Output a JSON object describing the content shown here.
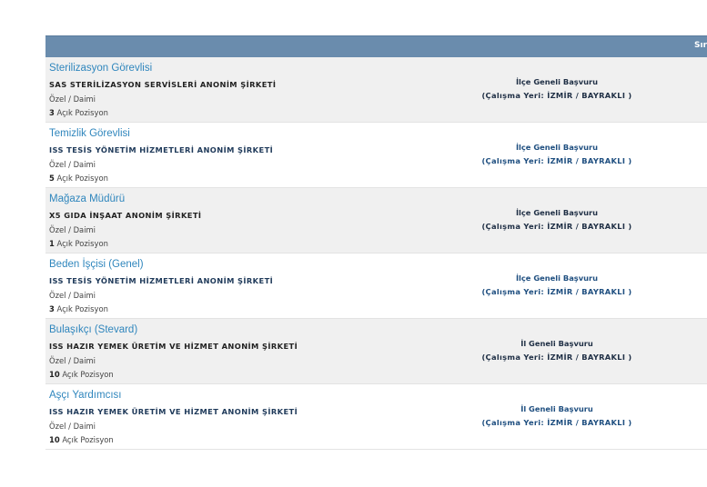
{
  "header": {
    "column_label": "Sır"
  },
  "listings": [
    {
      "title": "Sterilizasyon Görevlisi",
      "company": "SAS STERİLİZASYON SERVİSLERİ ANONİM ŞİRKETİ",
      "type": "Özel / Daimi",
      "count": "3",
      "count_label": "Açık Pozisyon",
      "scope": "İlçe Geneli Başvuru",
      "location": "(Çalışma Yeri: İZMİR / BAYRAKLI )"
    },
    {
      "title": "Temizlik Görevlisi",
      "company": "ISS TESİS YÖNETİM HİZMETLERİ ANONİM ŞİRKETİ",
      "type": "Özel / Daimi",
      "count": "5",
      "count_label": "Açık Pozisyon",
      "scope": "İlçe Geneli Başvuru",
      "location": "(Çalışma Yeri: İZMİR / BAYRAKLI )"
    },
    {
      "title": "Mağaza Müdürü",
      "company": "X5 GIDA İNŞAAT ANONİM ŞİRKETİ",
      "type": "Özel / Daimi",
      "count": "1",
      "count_label": "Açık Pozisyon",
      "scope": "İlçe Geneli Başvuru",
      "location": "(Çalışma Yeri: İZMİR / BAYRAKLI )"
    },
    {
      "title": "Beden İşçisi (Genel)",
      "company": "ISS TESİS YÖNETİM HİZMETLERİ ANONİM ŞİRKETİ",
      "type": "Özel / Daimi",
      "count": "3",
      "count_label": "Açık Pozisyon",
      "scope": "İlçe Geneli Başvuru",
      "location": "(Çalışma Yeri: İZMİR / BAYRAKLI )"
    },
    {
      "title": "Bulaşıkçı (Stevard)",
      "company": "ISS HAZIR YEMEK ÜRETİM VE HİZMET ANONİM ŞİRKETİ",
      "type": "Özel / Daimi",
      "count": "10",
      "count_label": "Açık Pozisyon",
      "scope": "İl Geneli Başvuru",
      "location": "(Çalışma Yeri: İZMİR / BAYRAKLI )"
    },
    {
      "title": "Aşçı Yardımcısı",
      "company": "ISS HAZIR YEMEK ÜRETİM VE HİZMET ANONİM ŞİRKETİ",
      "type": "Özel / Daimi",
      "count": "10",
      "count_label": "Açık Pozisyon",
      "scope": "İl Geneli Başvuru",
      "location": "(Çalışma Yeri: İZMİR / BAYRAKLI )"
    }
  ]
}
